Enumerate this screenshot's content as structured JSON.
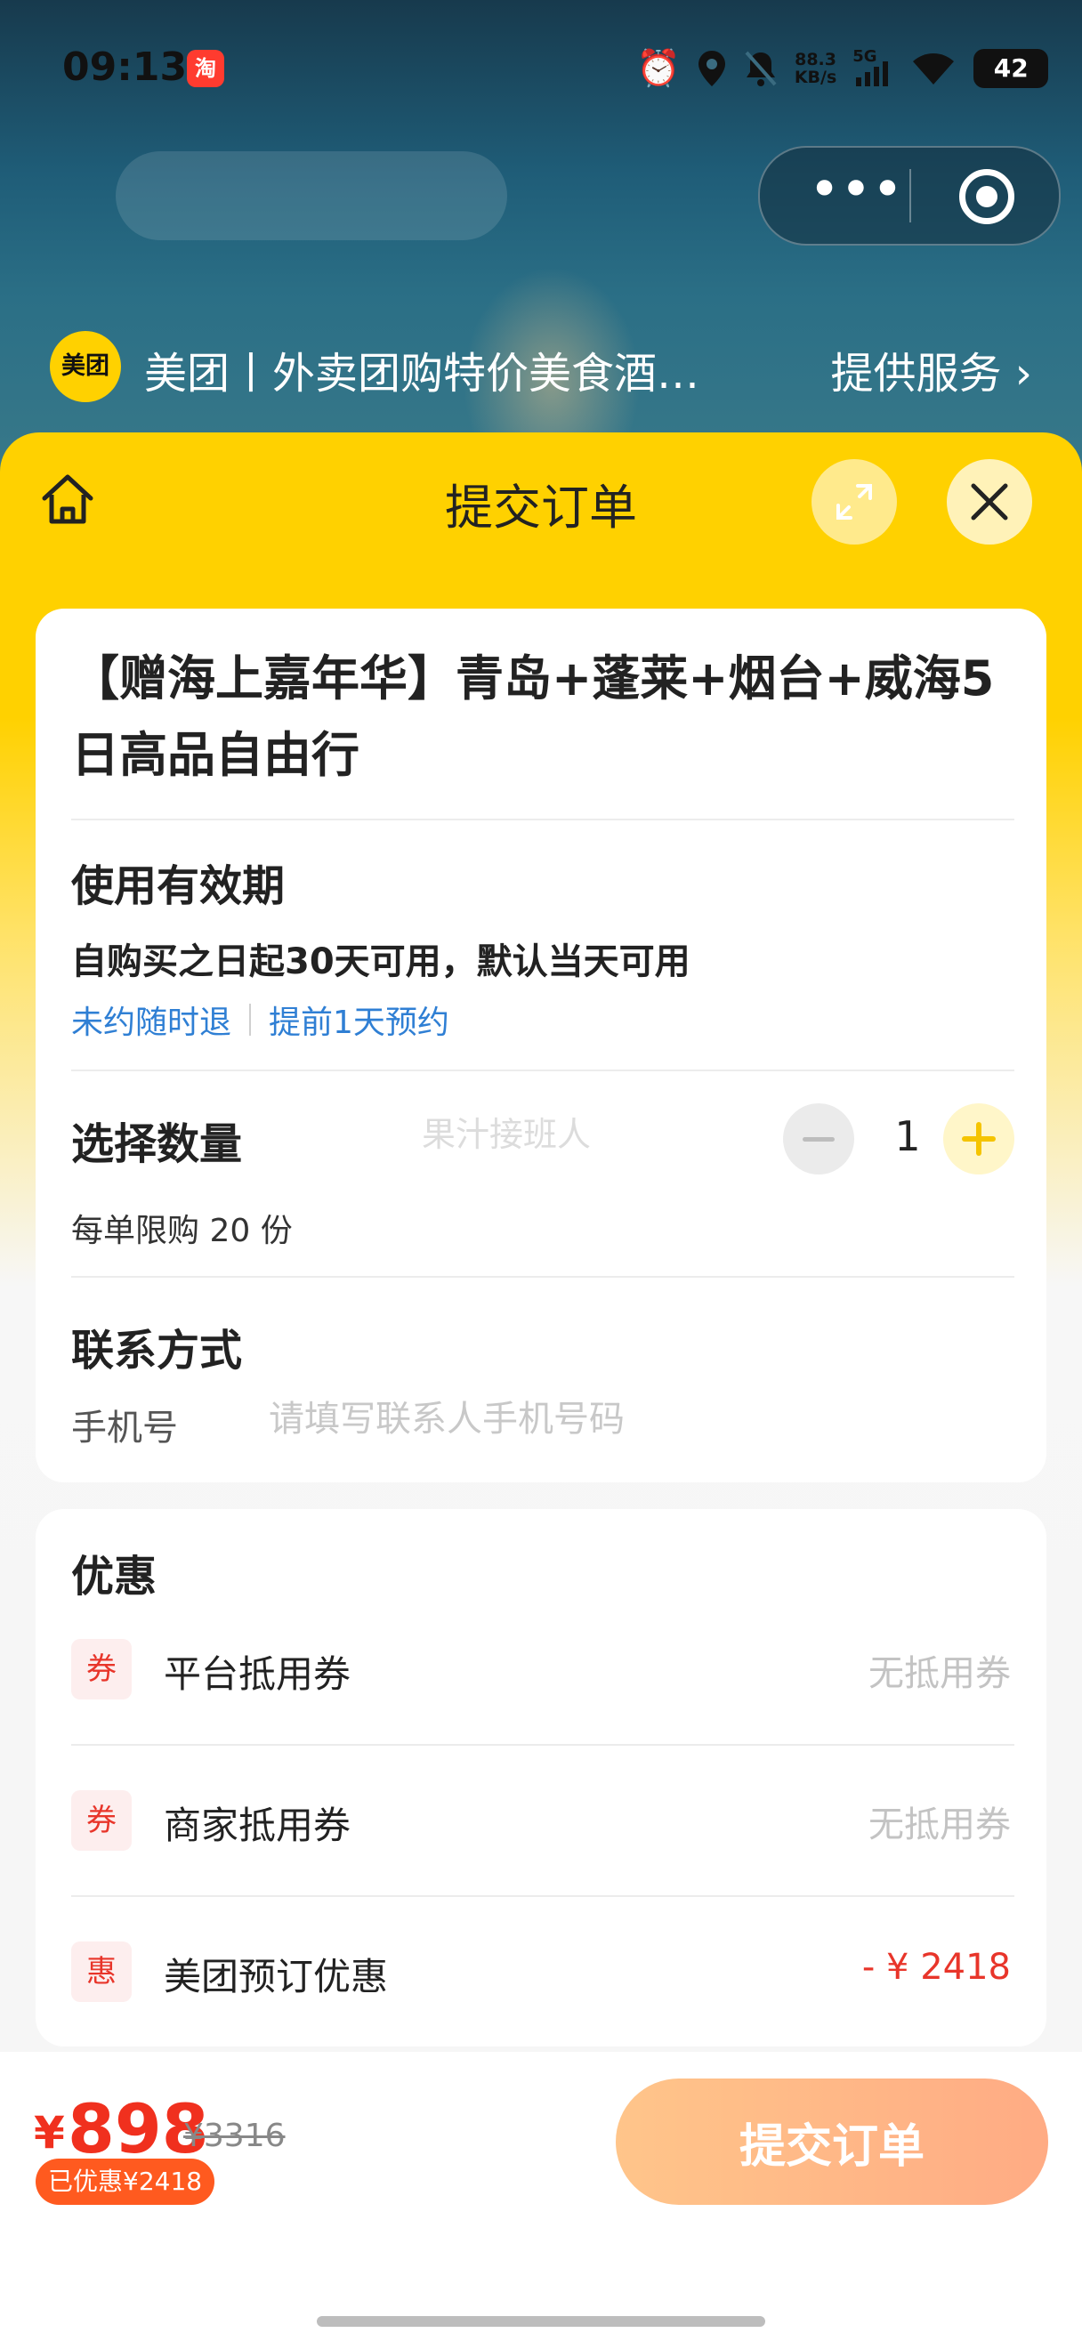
{
  "status_bar": {
    "time": "09:13",
    "app_badge": "淘",
    "net_speed_value": "88.3",
    "net_speed_unit": "KB/s",
    "network": "5G",
    "battery": "42"
  },
  "mini_program": {
    "logo_text": "美团",
    "title": "美团丨外卖团购特价美食酒…",
    "service_link": "提供服务"
  },
  "sheet": {
    "title": "提交订单"
  },
  "product": {
    "title": "【赠海上嘉年华】青岛+蓬莱+烟台+威海5日高品自由行",
    "validity_heading": "使用有效期",
    "validity_text": "自购买之日起30天可用，默认当天可用",
    "tags": [
      "未约随时退",
      "提前1天预约"
    ]
  },
  "quantity": {
    "heading": "选择数量",
    "watermark": "果汁接班人",
    "value": "1",
    "limit_text": "每单限购 20 份"
  },
  "contact": {
    "heading": "联系方式",
    "phone_label": "手机号",
    "phone_placeholder": "请填写联系人手机号码",
    "phone_value": ""
  },
  "discounts": {
    "heading": "优惠",
    "items": [
      {
        "badge": "券",
        "label": "平台抵用券",
        "value": "无抵用券"
      },
      {
        "badge": "券",
        "label": "商家抵用券",
        "value": "无抵用券"
      },
      {
        "badge": "惠",
        "label": "美团预订优惠",
        "value": "- ¥ 2418"
      }
    ]
  },
  "footer": {
    "currency": "¥",
    "price": "898",
    "original_price": "¥3316",
    "saved": "已优惠¥2418",
    "submit_label": "提交订单"
  },
  "colors": {
    "brand_yellow": "#ffd100",
    "price_red": "#f0301e",
    "link_blue": "#2f7fd4",
    "submit_gradient": "#ffc58a"
  }
}
